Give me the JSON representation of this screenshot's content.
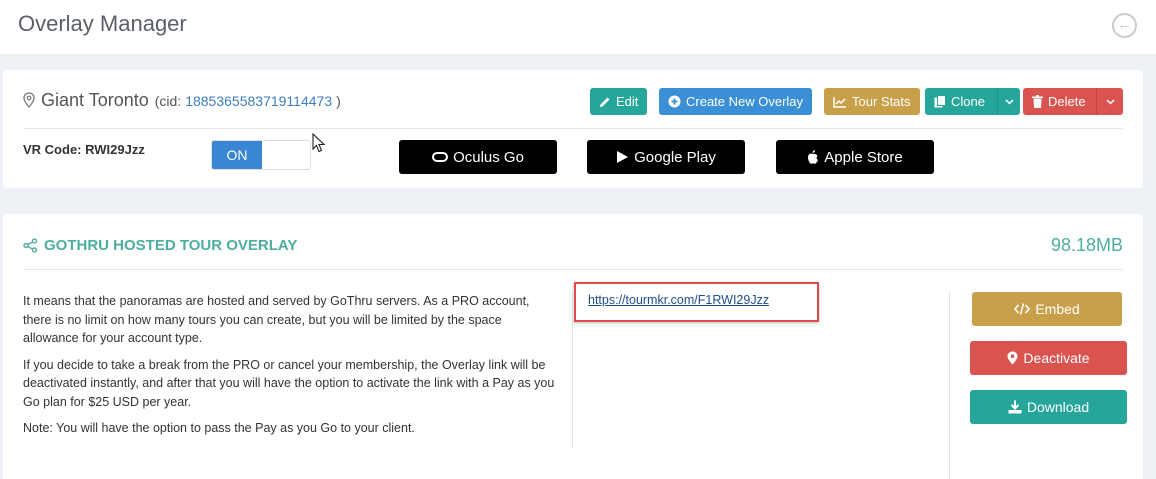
{
  "header": {
    "title": "Overlay Manager",
    "back_icon": "arrow-left-circle-icon"
  },
  "tour": {
    "name": "Giant Toronto",
    "cid_prefix": "(cid:",
    "cid": "1885365583719114473",
    "cid_suffix": ")",
    "vr_code_label": "VR Code: RWI29Jzz",
    "toggle_state": "ON"
  },
  "toolbar": {
    "edit": "Edit",
    "create": "Create New Overlay",
    "stats": "Tour Stats",
    "clone": "Clone",
    "delete": "Delete"
  },
  "stores": {
    "oculus": "Oculus Go",
    "google": "Google Play",
    "apple": "Apple Store"
  },
  "section": {
    "title": "GOTHRU HOSTED TOUR OVERLAY",
    "size": "98.18MB",
    "paragraphs": [
      "It means that the panoramas are hosted and served by GoThru servers. As a PRO account, there is no limit on how many tours you can create, but you will be limited by the space allowance for your account type.",
      "If you decide to take a break from the PRO or cancel your membership, the Overlay link will be deactivated instantly, and after that you will have the option to activate the link with a Pay as you Go plan for $25 USD per year.",
      "Note: You will have the option to pass the Pay as you Go to your client."
    ],
    "link": "https://tourmkr.com/F1RWI29Jzz",
    "actions": {
      "embed": "Embed",
      "deactivate": "Deactivate",
      "download": "Download"
    }
  },
  "colors": {
    "teal": "#26a69a",
    "blue": "#3a8fd6",
    "gold": "#c8a04a",
    "red": "#d9534f",
    "section_title": "#4cae9e",
    "highlight_border": "#e04a4a"
  }
}
